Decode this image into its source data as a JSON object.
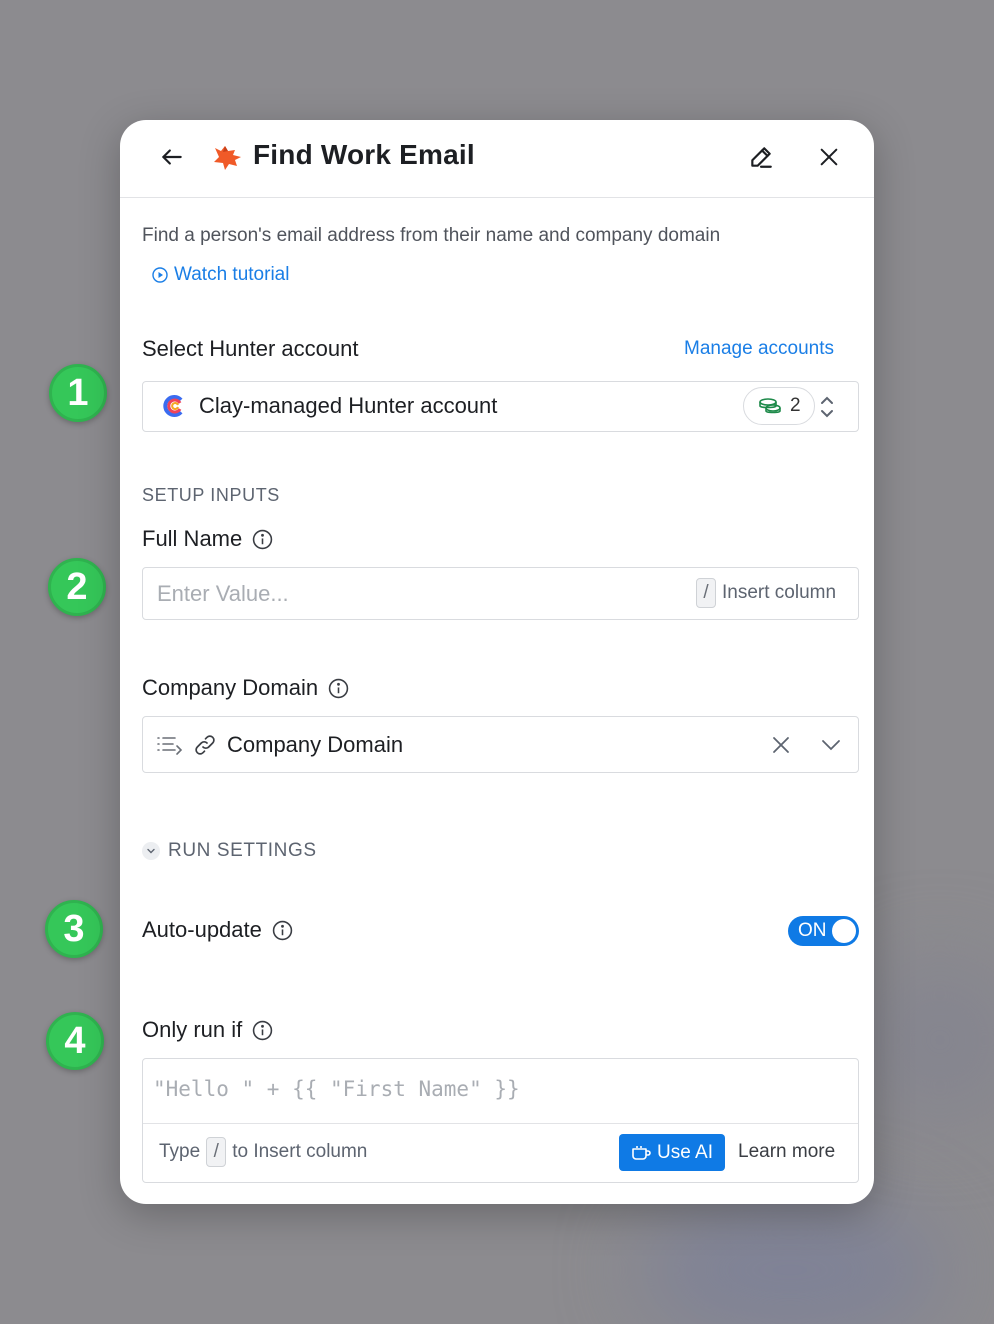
{
  "badges": [
    "1",
    "2",
    "3",
    "4"
  ],
  "header": {
    "title": "Find Work Email",
    "back_icon": "arrow-left-icon",
    "logo_icon": "hunter-fox-logo",
    "edit_icon": "pencil-icon",
    "close_icon": "close-icon"
  },
  "description": "Find a person's email address from their name and company domain",
  "watch_tutorial": "Watch tutorial",
  "account": {
    "label": "Select Hunter account",
    "manage_link": "Manage accounts",
    "selected": "Clay-managed Hunter account",
    "credits": "2"
  },
  "setup": {
    "heading": "SETUP INPUTS",
    "full_name": {
      "label": "Full Name",
      "placeholder": "Enter Value...",
      "slash": "/",
      "insert_column": "Insert column"
    },
    "company_domain": {
      "label": "Company Domain",
      "value": "Company Domain"
    }
  },
  "run_settings": {
    "heading": "RUN SETTINGS",
    "auto_update": {
      "label": "Auto-update",
      "toggle": "ON",
      "enabled": true
    },
    "only_run_if": {
      "label": "Only run if",
      "placeholder": "\"Hello \" + {{ \"First Name\" }}",
      "hint_prefix": "Type",
      "slash": "/",
      "hint_suffix": "to Insert column",
      "use_ai": "Use AI",
      "learn_more": "Learn more"
    }
  },
  "colors": {
    "accent": "#0f7ae5",
    "badge": "#35c759",
    "brand": "#f05a28"
  }
}
